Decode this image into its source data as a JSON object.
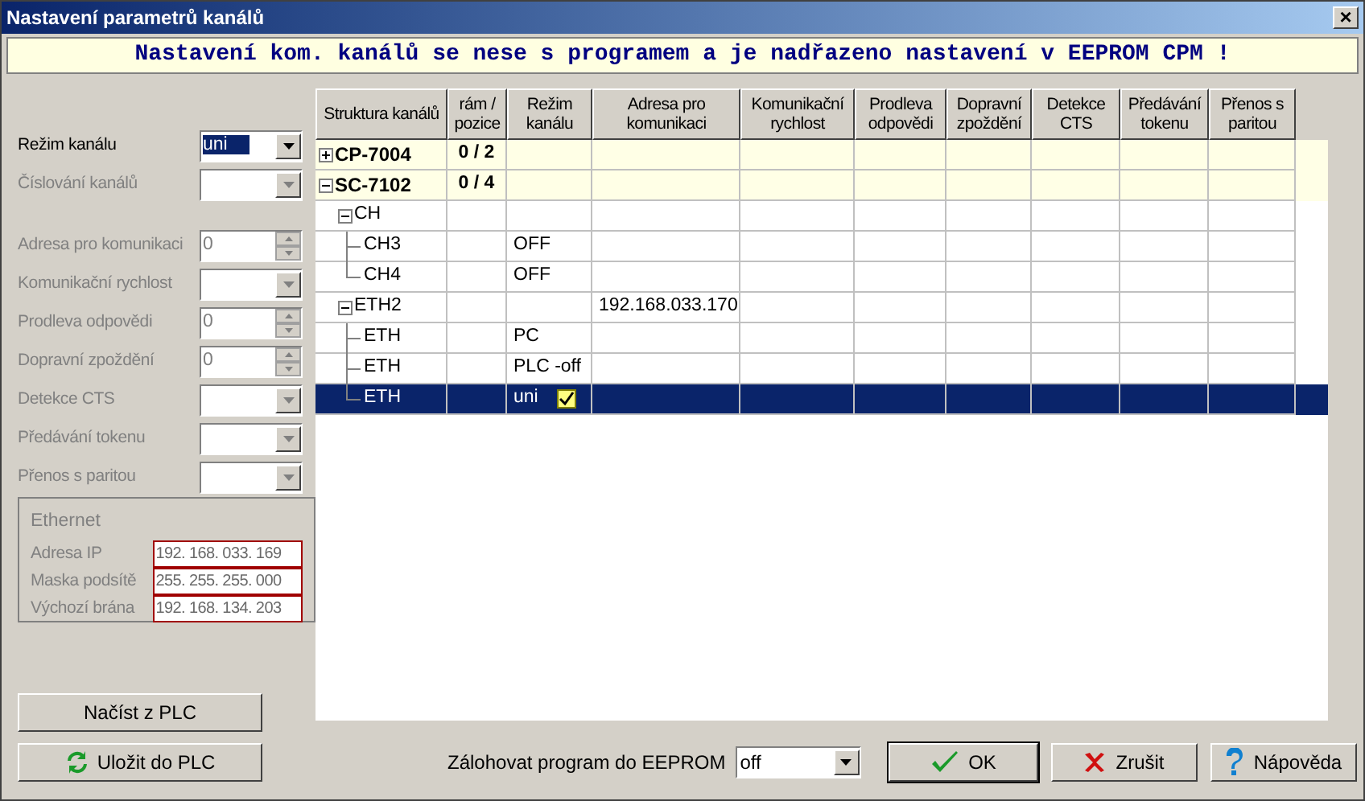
{
  "window": {
    "title": "Nastavení parametrů kanálů",
    "close": "×"
  },
  "banner": "Nastavení kom. kanálů se nese s programem a je nadřazeno nastavení v EEPROM CPM !",
  "settings": [
    {
      "kind": "dropdown",
      "label": "Režim kanálu",
      "value": "uni",
      "disabled": false
    },
    {
      "kind": "dropdown",
      "label": "Číslování kanálů",
      "disabled": true
    },
    {
      "kind": "spin",
      "label": "Adresa pro komunikaci",
      "value": "0",
      "disabled": true
    },
    {
      "kind": "dropdown",
      "label": "Komunikační rychlost",
      "disabled": true
    },
    {
      "kind": "spin",
      "label": "Prodleva odpovědi",
      "value": "0",
      "disabled": true
    },
    {
      "kind": "spin",
      "label": "Dopravní zpoždění",
      "value": "0",
      "disabled": true
    },
    {
      "kind": "dropdown",
      "label": "Detekce CTS",
      "disabled": true
    },
    {
      "kind": "dropdown",
      "label": "Předávání tokenu",
      "disabled": true
    },
    {
      "kind": "dropdown",
      "label": "Přenos s paritou",
      "disabled": true
    }
  ],
  "ethernet": {
    "title": "Ethernet",
    "fields": [
      {
        "label": "Adresa IP",
        "value": "192. 168. 033. 169"
      },
      {
        "label": "Maska podsítě",
        "value": "255. 255. 255. 000"
      },
      {
        "label": "Výchozí brána",
        "value": "192. 168. 134. 203"
      }
    ]
  },
  "table": {
    "columns": [
      "Struktura kanálů",
      "rám / pozice",
      "Režim kanálu",
      "Adresa pro komunikaci",
      "Komunikační rychlost",
      "Prodleva odpovědi",
      "Dopravní zpoždění",
      "Detekce CTS",
      "Předávání tokenu",
      "Přenos s paritou"
    ],
    "rows": [
      {
        "kind": "module",
        "label": "CP-7004",
        "position": "0 / 2",
        "expanded": false,
        "selected": false
      },
      {
        "kind": "module",
        "label": "SC-7102",
        "position": "0 / 4",
        "expanded": true,
        "selected": false,
        "children": [
          {
            "kind": "group",
            "label": "CH",
            "expanded": true,
            "selected": false,
            "children": [
              {
                "kind": "channel",
                "label": "CH3",
                "mode": "OFF",
                "selected": false
              },
              {
                "kind": "channel",
                "label": "CH4",
                "mode": "OFF",
                "selected": false
              }
            ]
          },
          {
            "kind": "group",
            "label": "ETH2",
            "address": "192.168.033.170",
            "expanded": true,
            "selected": false,
            "children": [
              {
                "kind": "channel",
                "label": "ETH",
                "mode": "PC",
                "selected": false
              },
              {
                "kind": "channel",
                "label": "ETH",
                "mode": "PLC -off",
                "selected": false
              },
              {
                "kind": "channel",
                "label": "ETH",
                "mode": "uni",
                "selected": true
              }
            ]
          }
        ]
      }
    ]
  },
  "buttons_left": [
    "Načíst z PLC",
    "Uložit do PLC"
  ],
  "backup": {
    "label": "Zálohovat program do EEPROM",
    "value": "off"
  },
  "buttons": [
    {
      "kind": "ok",
      "label": "OK"
    },
    {
      "kind": "cancel",
      "label": "Zrušit"
    },
    {
      "kind": "help",
      "label": "Nápověda"
    }
  ]
}
